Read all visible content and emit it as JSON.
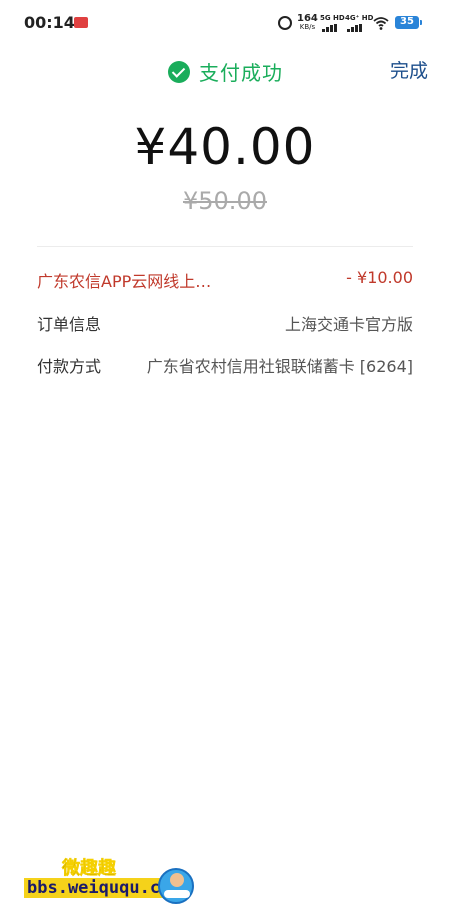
{
  "status_bar": {
    "time": "00:14",
    "net_speed_value": "164",
    "net_speed_unit": "KB/s",
    "signal1_label": "5G HD",
    "signal2_label": "4G⁺ HD",
    "battery": "35",
    "icons": [
      "notification-icon",
      "alarm-icon",
      "wifi-icon",
      "battery-icon"
    ]
  },
  "header": {
    "status_text": "支付成功",
    "done_label": "完成",
    "status_color": "#1aad5b",
    "done_color": "#1d4f8c"
  },
  "payment": {
    "amount": "¥40.00",
    "original_amount": "¥50.00"
  },
  "details": {
    "discount": {
      "label": "广东农信APP云网线上…",
      "value": "- ¥10.00",
      "color": "#c0392b"
    },
    "order": {
      "label": "订单信息",
      "value": "上海交通卡官方版"
    },
    "payment_method": {
      "label": "付款方式",
      "value": "广东省农村信用社银联储蓄卡 [6264]"
    }
  },
  "watermark": {
    "title": "微趣趣",
    "url": "bbs.weiququ.cn"
  }
}
